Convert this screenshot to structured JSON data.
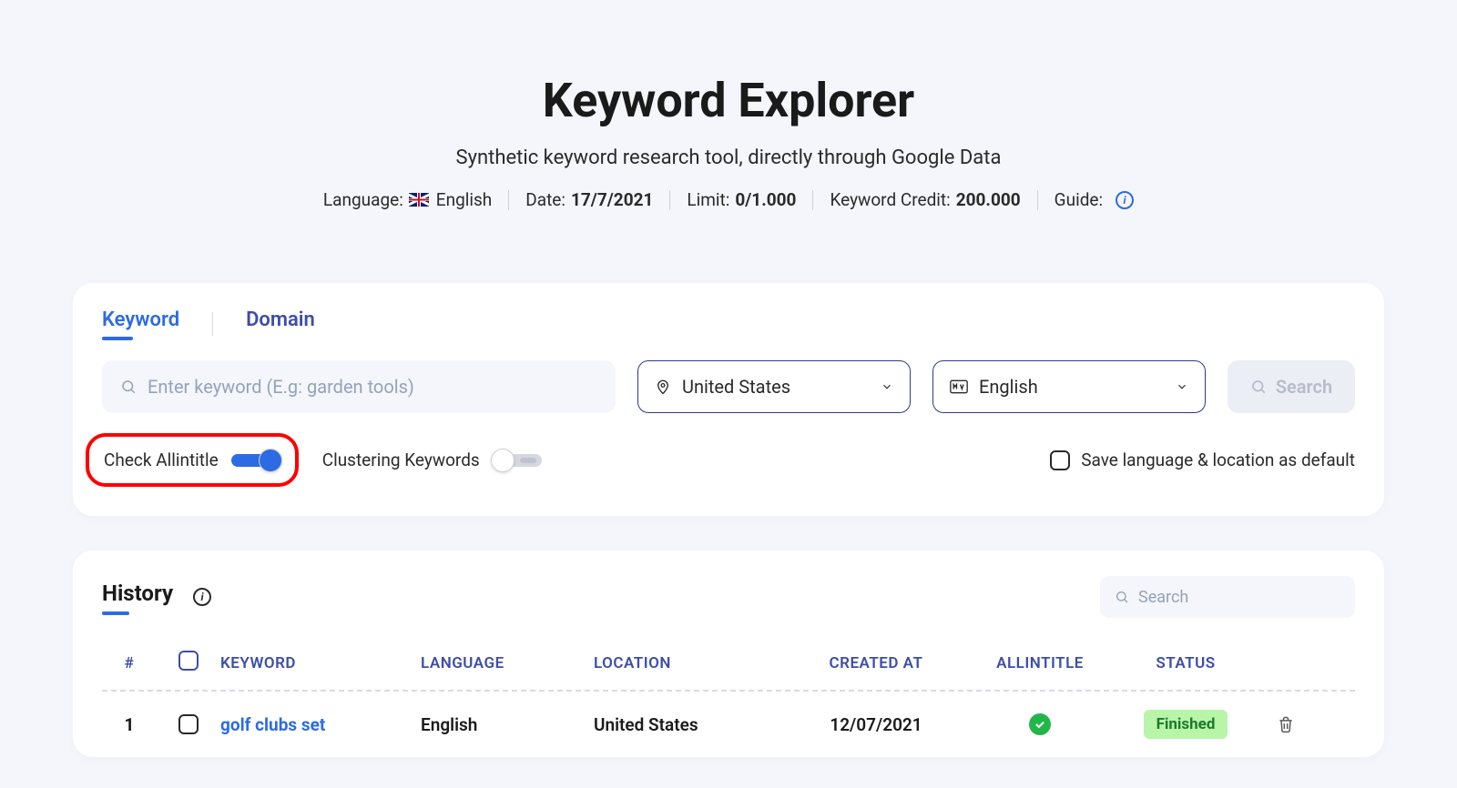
{
  "header": {
    "title": "Keyword Explorer",
    "subtitle": "Synthetic keyword research tool, directly through Google Data",
    "language_label": "Language:",
    "language_value": "English",
    "date_label": "Date:",
    "date_value": "17/7/2021",
    "limit_label": "Limit:",
    "limit_value": "0/1.000",
    "credit_label": "Keyword Credit:",
    "credit_value": "200.000",
    "guide_label": "Guide:"
  },
  "tabs": {
    "keyword": "Keyword",
    "domain": "Domain"
  },
  "form": {
    "keyword_placeholder": "Enter keyword (E.g: garden tools)",
    "country": "United States",
    "language": "English",
    "search_button": "Search",
    "check_allintitle": "Check Allintitle",
    "clustering": "Clustering Keywords",
    "save_default": "Save language & location as default"
  },
  "history": {
    "title": "History",
    "search_placeholder": "Search",
    "columns": {
      "idx": "#",
      "keyword": "KEYWORD",
      "language": "LANGUAGE",
      "location": "LOCATION",
      "created": "CREATED AT",
      "allintitle": "ALLINTITLE",
      "status": "STATUS"
    },
    "rows": [
      {
        "idx": "1",
        "keyword": "golf clubs set",
        "language": "English",
        "location": "United States",
        "created": "12/07/2021",
        "allintitle": true,
        "status": "Finished"
      }
    ]
  }
}
